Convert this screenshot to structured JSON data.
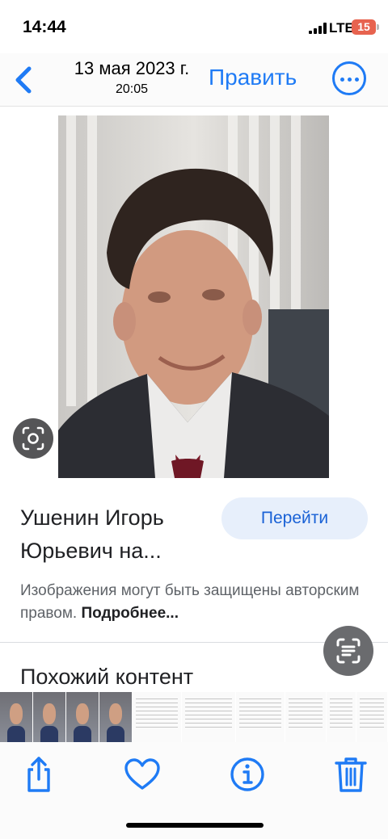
{
  "status_bar": {
    "time": "14:44",
    "network": "LTE",
    "battery": "15"
  },
  "nav": {
    "date": "13 мая 2023 г.",
    "time": "20:05",
    "edit_label": "Править",
    "back_icon": "chevron-left-icon",
    "more_icon": "ellipsis-circle-icon"
  },
  "result": {
    "title": "Ушенин Игорь Юрьевич на...",
    "goto_label": "Перейти",
    "copyright_text": "Изображения могут быть защищены авторским правом.",
    "more_link": "Подробнее..."
  },
  "similar": {
    "heading": "Похожий контент"
  },
  "thumbnails": [
    {
      "kind": "face"
    },
    {
      "kind": "face"
    },
    {
      "kind": "face"
    },
    {
      "kind": "face"
    },
    {
      "kind": "doc"
    },
    {
      "kind": "doc"
    },
    {
      "kind": "doc"
    },
    {
      "kind": "doc"
    },
    {
      "kind": "doc"
    },
    {
      "kind": "doc"
    },
    {
      "kind": "doc"
    },
    {
      "kind": "doc"
    }
  ],
  "toolbar": {
    "items": [
      "share-icon",
      "heart-icon",
      "info-icon",
      "trash-icon"
    ]
  },
  "colors": {
    "accent": "#1f7bf5",
    "battery": "#e7634f",
    "goto_bg": "#e7effb",
    "goto_text": "#1a62d6"
  }
}
